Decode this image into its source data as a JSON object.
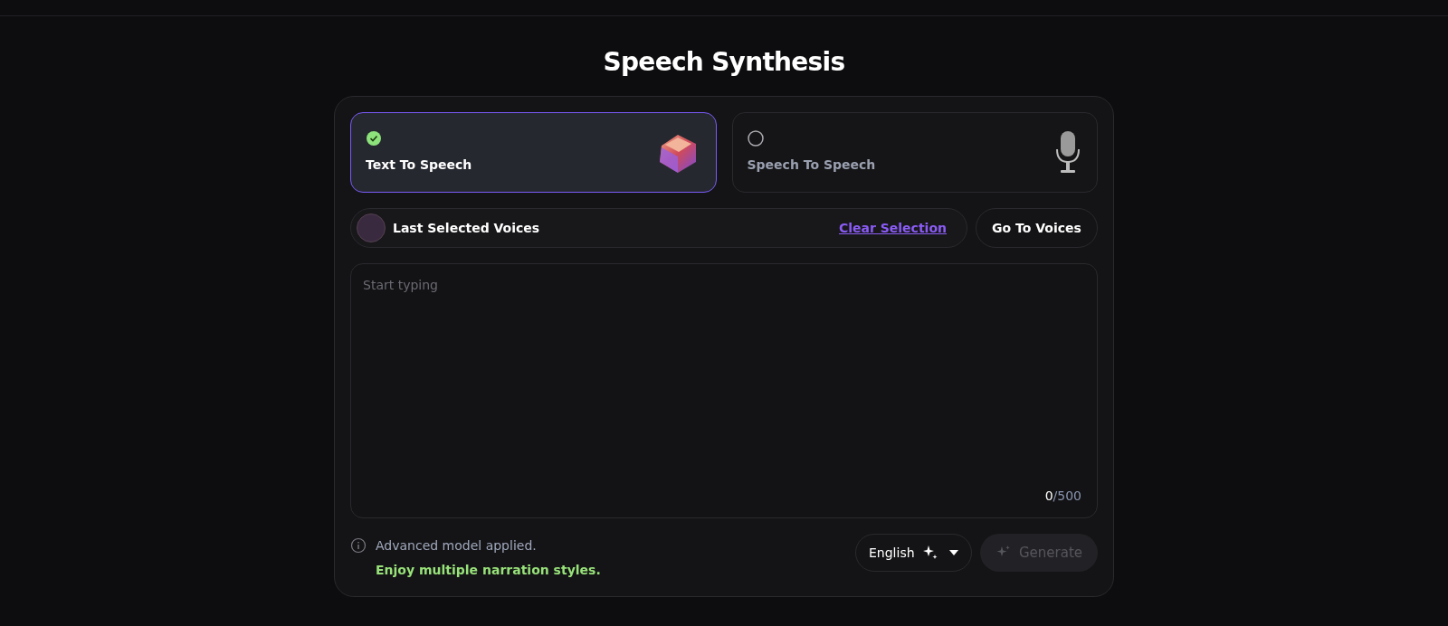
{
  "title": "Speech Synthesis",
  "modes": [
    {
      "label": "Text To Speech",
      "selected": true,
      "kind": "keycap"
    },
    {
      "label": "Speech To Speech",
      "selected": false,
      "kind": "microphone"
    }
  ],
  "voices": {
    "label": "Last Selected Voices",
    "clear_link": "Clear Selection",
    "go_button": "Go To Voices"
  },
  "editor": {
    "placeholder": "Start typing",
    "count": "0",
    "limit": "/500"
  },
  "notice": {
    "line_1": "Advanced model applied.",
    "line_2": "Enjoy multiple narration styles."
  },
  "language": {
    "value": "English"
  },
  "generate": {
    "label": "Generate",
    "disabled": true
  }
}
